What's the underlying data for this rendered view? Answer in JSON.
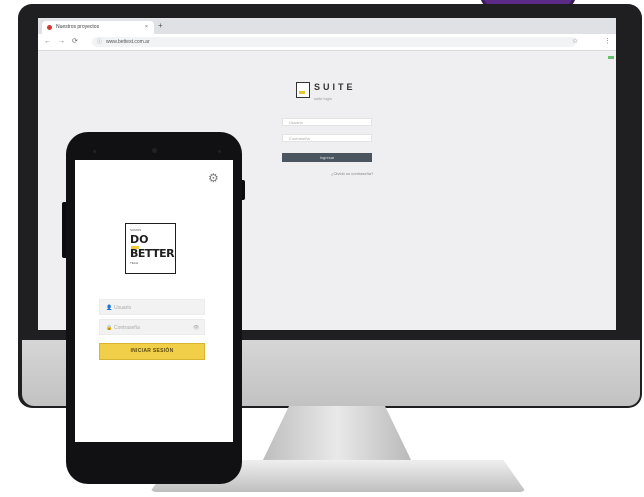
{
  "browser": {
    "tab_title": "Nuestros proyectos",
    "tab_close": "×",
    "new_tab": "+",
    "back": "←",
    "forward": "→",
    "reload": "⟳",
    "url_icon": "ⓘ",
    "url": "www.bettest.com.ar",
    "star": "☆",
    "menu": "⋮"
  },
  "web_login": {
    "brand": "SUITE",
    "brand_sub": "suite login",
    "username_placeholder": "Usuario",
    "password_placeholder": "Contraseña",
    "submit_label": "Ingresar",
    "forgot_label": "¿Olvidó su contraseña?"
  },
  "mobile_login": {
    "settings_icon": "gear-icon",
    "logo_line1": "DO",
    "logo_line2": "BETTER",
    "logo_tiny_top": "SOMOS",
    "logo_tiny_bottom": "TECH",
    "username_placeholder": "Usuario",
    "password_placeholder": "Contraseña",
    "user_icon_glyph": "👤",
    "lock_icon_glyph": "🔒",
    "eye_icon_glyph": "👁",
    "submit_label": "INICIAR SESIÓN"
  },
  "colors": {
    "accent_yellow": "#f2cf48",
    "web_button": "#4a5560",
    "purple": "#5b2a86"
  }
}
